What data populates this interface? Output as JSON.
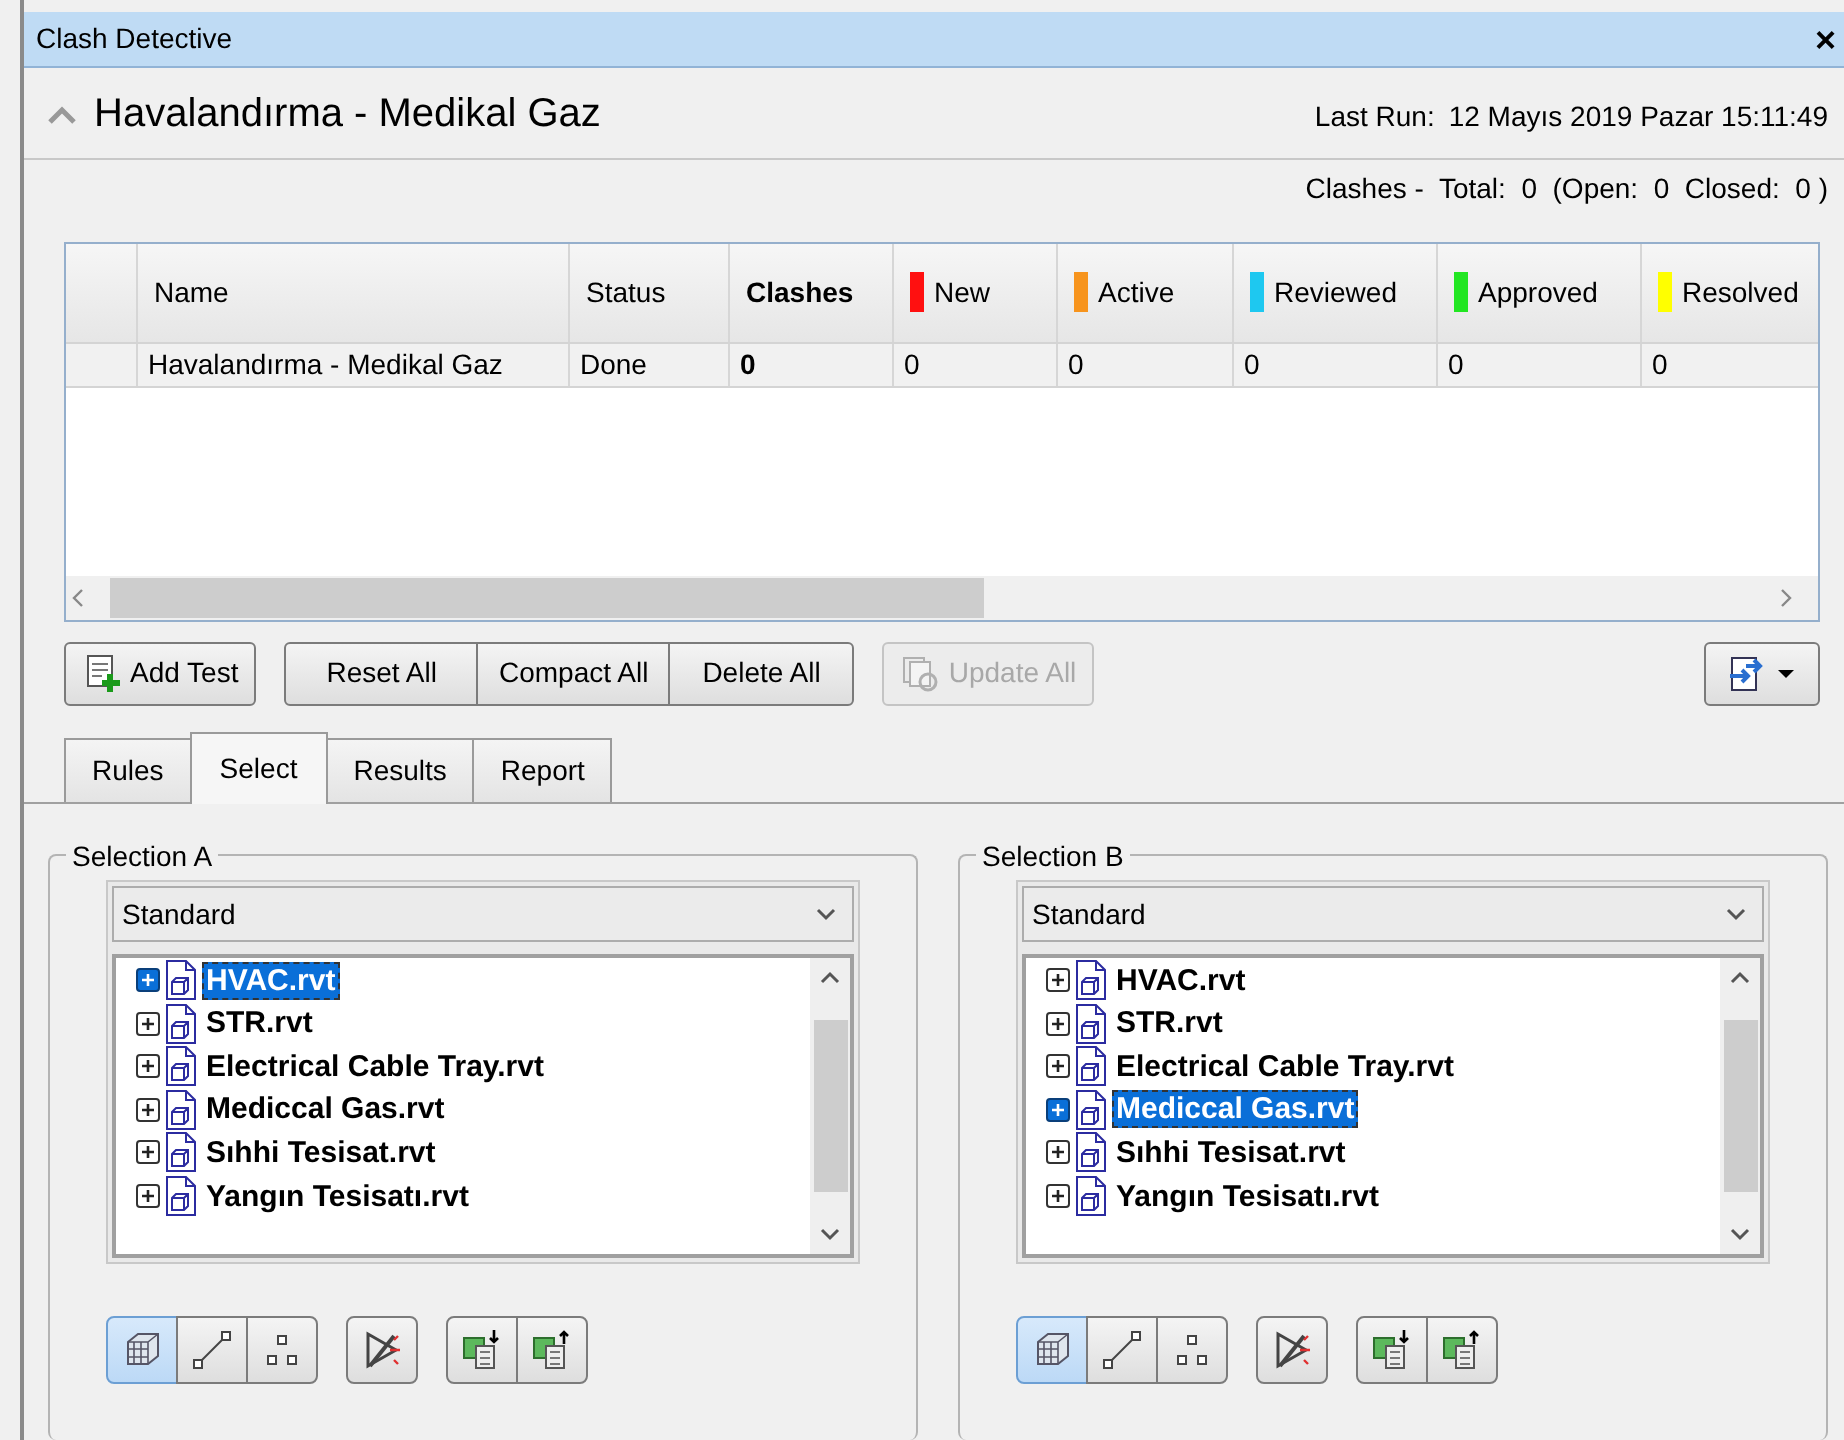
{
  "window": {
    "title": "Clash Detective",
    "close": "×"
  },
  "test": {
    "name": "Havalandırma - Medikal Gaz",
    "last_run_label": "Last Run:",
    "last_run": "12 Mayıs 2019 Pazar 15:11:49",
    "summary": "Clashes -  Total:  0  (Open:  0  Closed:  0 )"
  },
  "table": {
    "columns": [
      {
        "label": "Name"
      },
      {
        "label": "Status"
      },
      {
        "label": "Clashes",
        "bold": true
      },
      {
        "label": "New",
        "color": "#ff1010"
      },
      {
        "label": "Active",
        "color": "#f7941d"
      },
      {
        "label": "Reviewed",
        "color": "#1ec8f0"
      },
      {
        "label": "Approved",
        "color": "#22e622"
      },
      {
        "label": "Resolved",
        "color": "#ffff00"
      }
    ],
    "rows": [
      {
        "cells": [
          "Havalandırma - Medikal Gaz",
          "Done",
          "0",
          "0",
          "0",
          "0",
          "0",
          "0"
        ]
      }
    ]
  },
  "toolbar": {
    "add_test": "Add Test",
    "group": [
      "Reset All",
      "Compact All",
      "Delete All"
    ],
    "update": {
      "label": "Update All",
      "disabled": true
    }
  },
  "tabs": [
    {
      "label": "Rules",
      "selected": false
    },
    {
      "label": "Select",
      "selected": true
    },
    {
      "label": "Results",
      "selected": false
    },
    {
      "label": "Report",
      "selected": false
    }
  ],
  "selections": [
    {
      "title": "Selection A",
      "mode": "Standard",
      "items": [
        {
          "label": "HVAC.rvt",
          "expanded": false,
          "selected": true
        },
        {
          "label": "STR.rvt",
          "expanded": false,
          "selected": false
        },
        {
          "label": "Electrical Cable Tray.rvt",
          "expanded": false,
          "selected": false
        },
        {
          "label": "Mediccal Gas.rvt",
          "expanded": false,
          "selected": false
        },
        {
          "label": "Sıhhi Tesisat.rvt",
          "expanded": false,
          "selected": false
        },
        {
          "label": "Yangın Tesisatı.rvt",
          "expanded": false,
          "selected": false
        }
      ],
      "tools": [
        [
          {
            "kind": "cube",
            "selected": true
          },
          {
            "kind": "line",
            "selected": false
          },
          {
            "kind": "points",
            "selected": false
          }
        ],
        [
          {
            "kind": "filter",
            "selected": false
          }
        ],
        [
          {
            "kind": "save",
            "selected": false
          },
          {
            "kind": "load",
            "selected": false
          }
        ]
      ]
    },
    {
      "title": "Selection B",
      "mode": "Standard",
      "items": [
        {
          "label": "HVAC.rvt",
          "expanded": false,
          "selected": false
        },
        {
          "label": "STR.rvt",
          "expanded": false,
          "selected": false
        },
        {
          "label": "Electrical Cable Tray.rvt",
          "expanded": false,
          "selected": false
        },
        {
          "label": "Mediccal Gas.rvt",
          "expanded": false,
          "selected": true
        },
        {
          "label": "Sıhhi Tesisat.rvt",
          "expanded": false,
          "selected": false
        },
        {
          "label": "Yangın Tesisatı.rvt",
          "expanded": false,
          "selected": false
        }
      ],
      "tools": [
        [
          {
            "kind": "cube",
            "selected": true
          },
          {
            "kind": "line",
            "selected": false
          },
          {
            "kind": "points",
            "selected": false
          }
        ],
        [
          {
            "kind": "filter",
            "selected": false
          }
        ],
        [
          {
            "kind": "save",
            "selected": false
          },
          {
            "kind": "load",
            "selected": false
          }
        ]
      ]
    }
  ]
}
